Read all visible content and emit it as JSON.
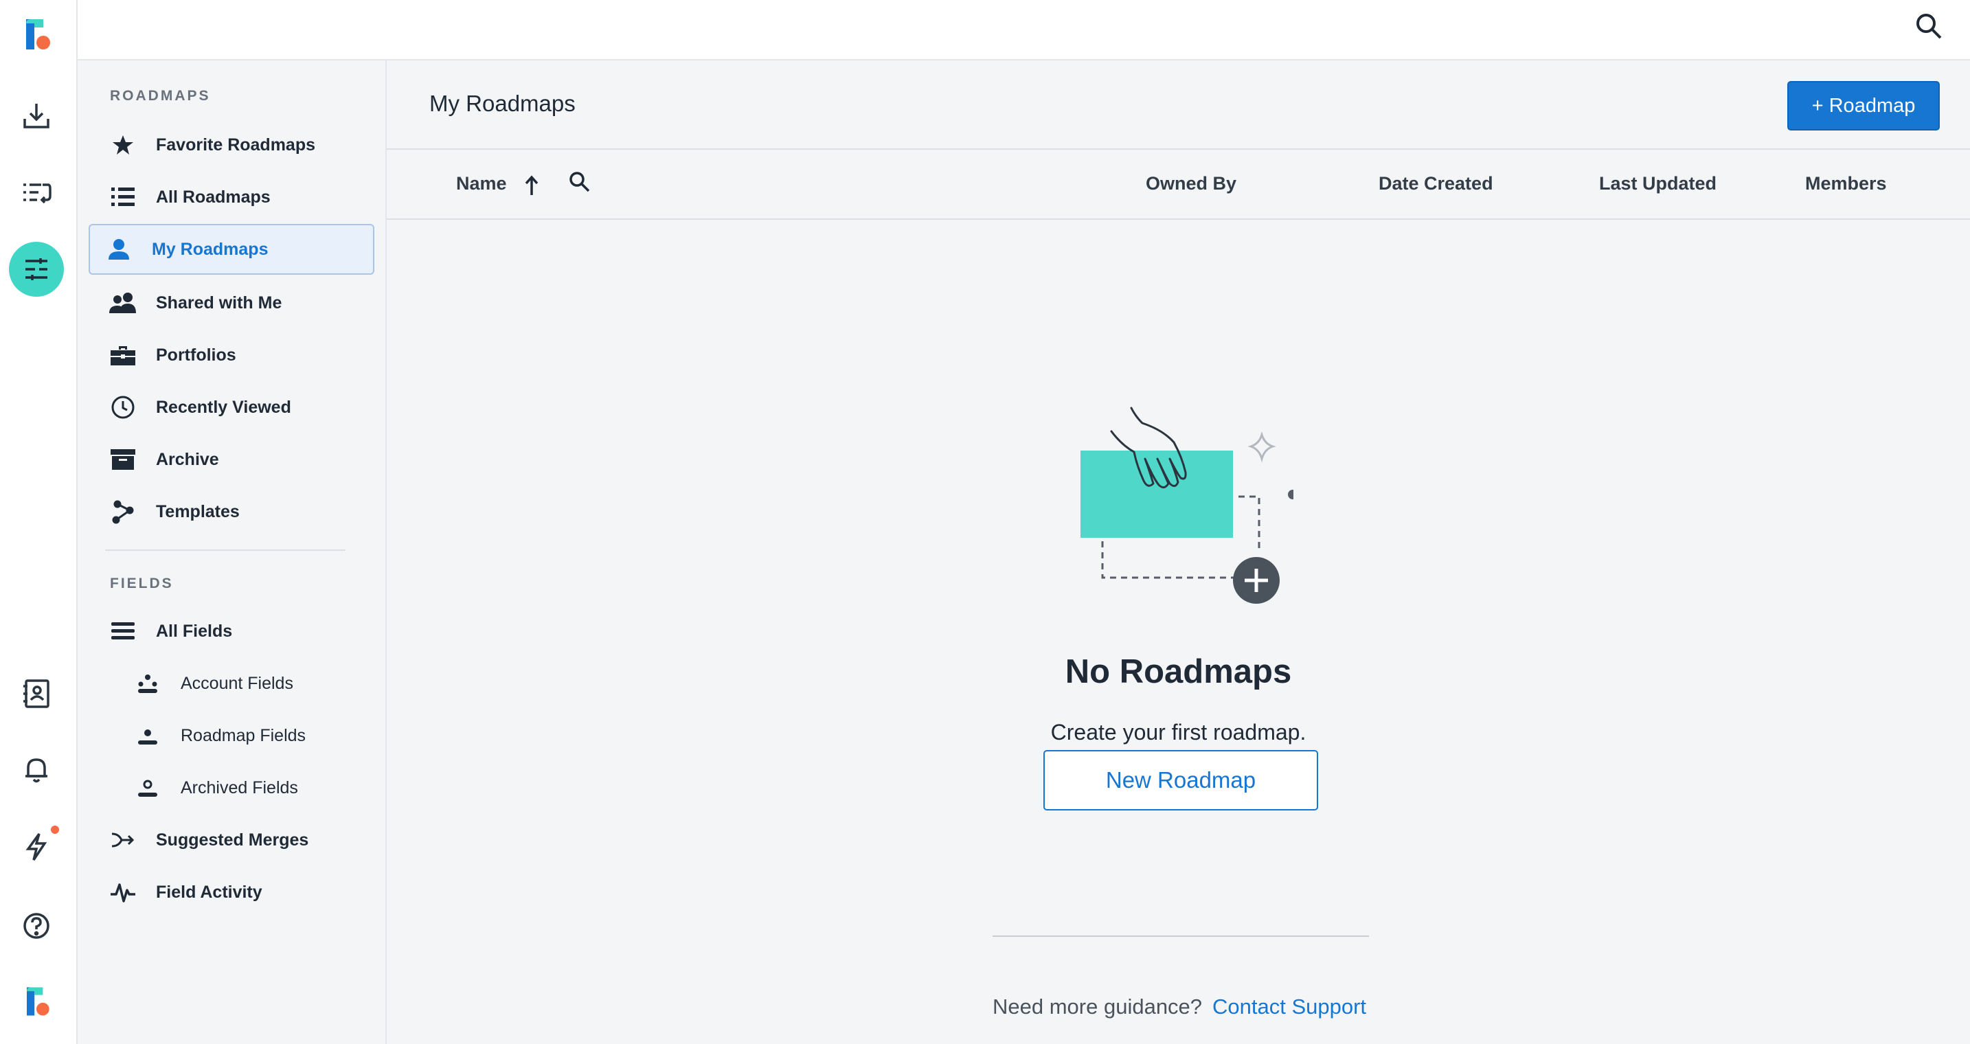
{
  "app": {
    "brand_colors": {
      "accent": "#1676d2",
      "teal": "#3fd6c6",
      "logo_orange": "#f56b42",
      "logo_blue": "#1676d2"
    }
  },
  "rail": {
    "items": [
      {
        "icon": "logo-icon"
      },
      {
        "icon": "download-tray-icon"
      },
      {
        "icon": "list-refresh-icon"
      },
      {
        "icon": "roadmaps-icon",
        "active": true
      },
      {
        "icon": "contacts-book-icon"
      },
      {
        "icon": "bell-icon"
      },
      {
        "icon": "lightning-icon",
        "notification": true
      },
      {
        "icon": "help-icon"
      },
      {
        "icon": "account-logo-icon"
      }
    ]
  },
  "topbar": {
    "search_icon": "search-icon"
  },
  "sidebar": {
    "roadmaps_title": "ROADMAPS",
    "roadmap_items": [
      {
        "label": "Favorite Roadmaps",
        "icon": "star-icon"
      },
      {
        "label": "All Roadmaps",
        "icon": "list-icon"
      },
      {
        "label": "My Roadmaps",
        "icon": "person-icon",
        "active": true
      },
      {
        "label": "Shared with Me",
        "icon": "people-icon"
      },
      {
        "label": "Portfolios",
        "icon": "briefcase-icon"
      },
      {
        "label": "Recently Viewed",
        "icon": "clock-icon"
      },
      {
        "label": "Archive",
        "icon": "archive-box-icon"
      },
      {
        "label": "Templates",
        "icon": "nodes-icon"
      }
    ],
    "fields_title": "FIELDS",
    "field_items": [
      {
        "label": "All Fields",
        "icon": "stack-icon"
      },
      {
        "label": "Account Fields",
        "icon": "account-fields-icon"
      },
      {
        "label": "Roadmap Fields",
        "icon": "roadmap-fields-icon"
      },
      {
        "label": "Archived Fields",
        "icon": "archived-fields-icon"
      },
      {
        "label": "Suggested Merges",
        "icon": "merge-arrow-icon"
      },
      {
        "label": "Field Activity",
        "icon": "pulse-icon"
      }
    ]
  },
  "main": {
    "title": "My Roadmaps",
    "add_button": "+ Roadmap",
    "columns": {
      "name": "Name",
      "owned_by": "Owned By",
      "date_created": "Date Created",
      "last_updated": "Last Updated",
      "members": "Members"
    },
    "empty": {
      "title": "No Roadmaps",
      "subtitle": "Create your first roadmap.",
      "button": "New Roadmap"
    },
    "footer": {
      "guidance": "Need more guidance?",
      "contact": "Contact Support"
    }
  }
}
